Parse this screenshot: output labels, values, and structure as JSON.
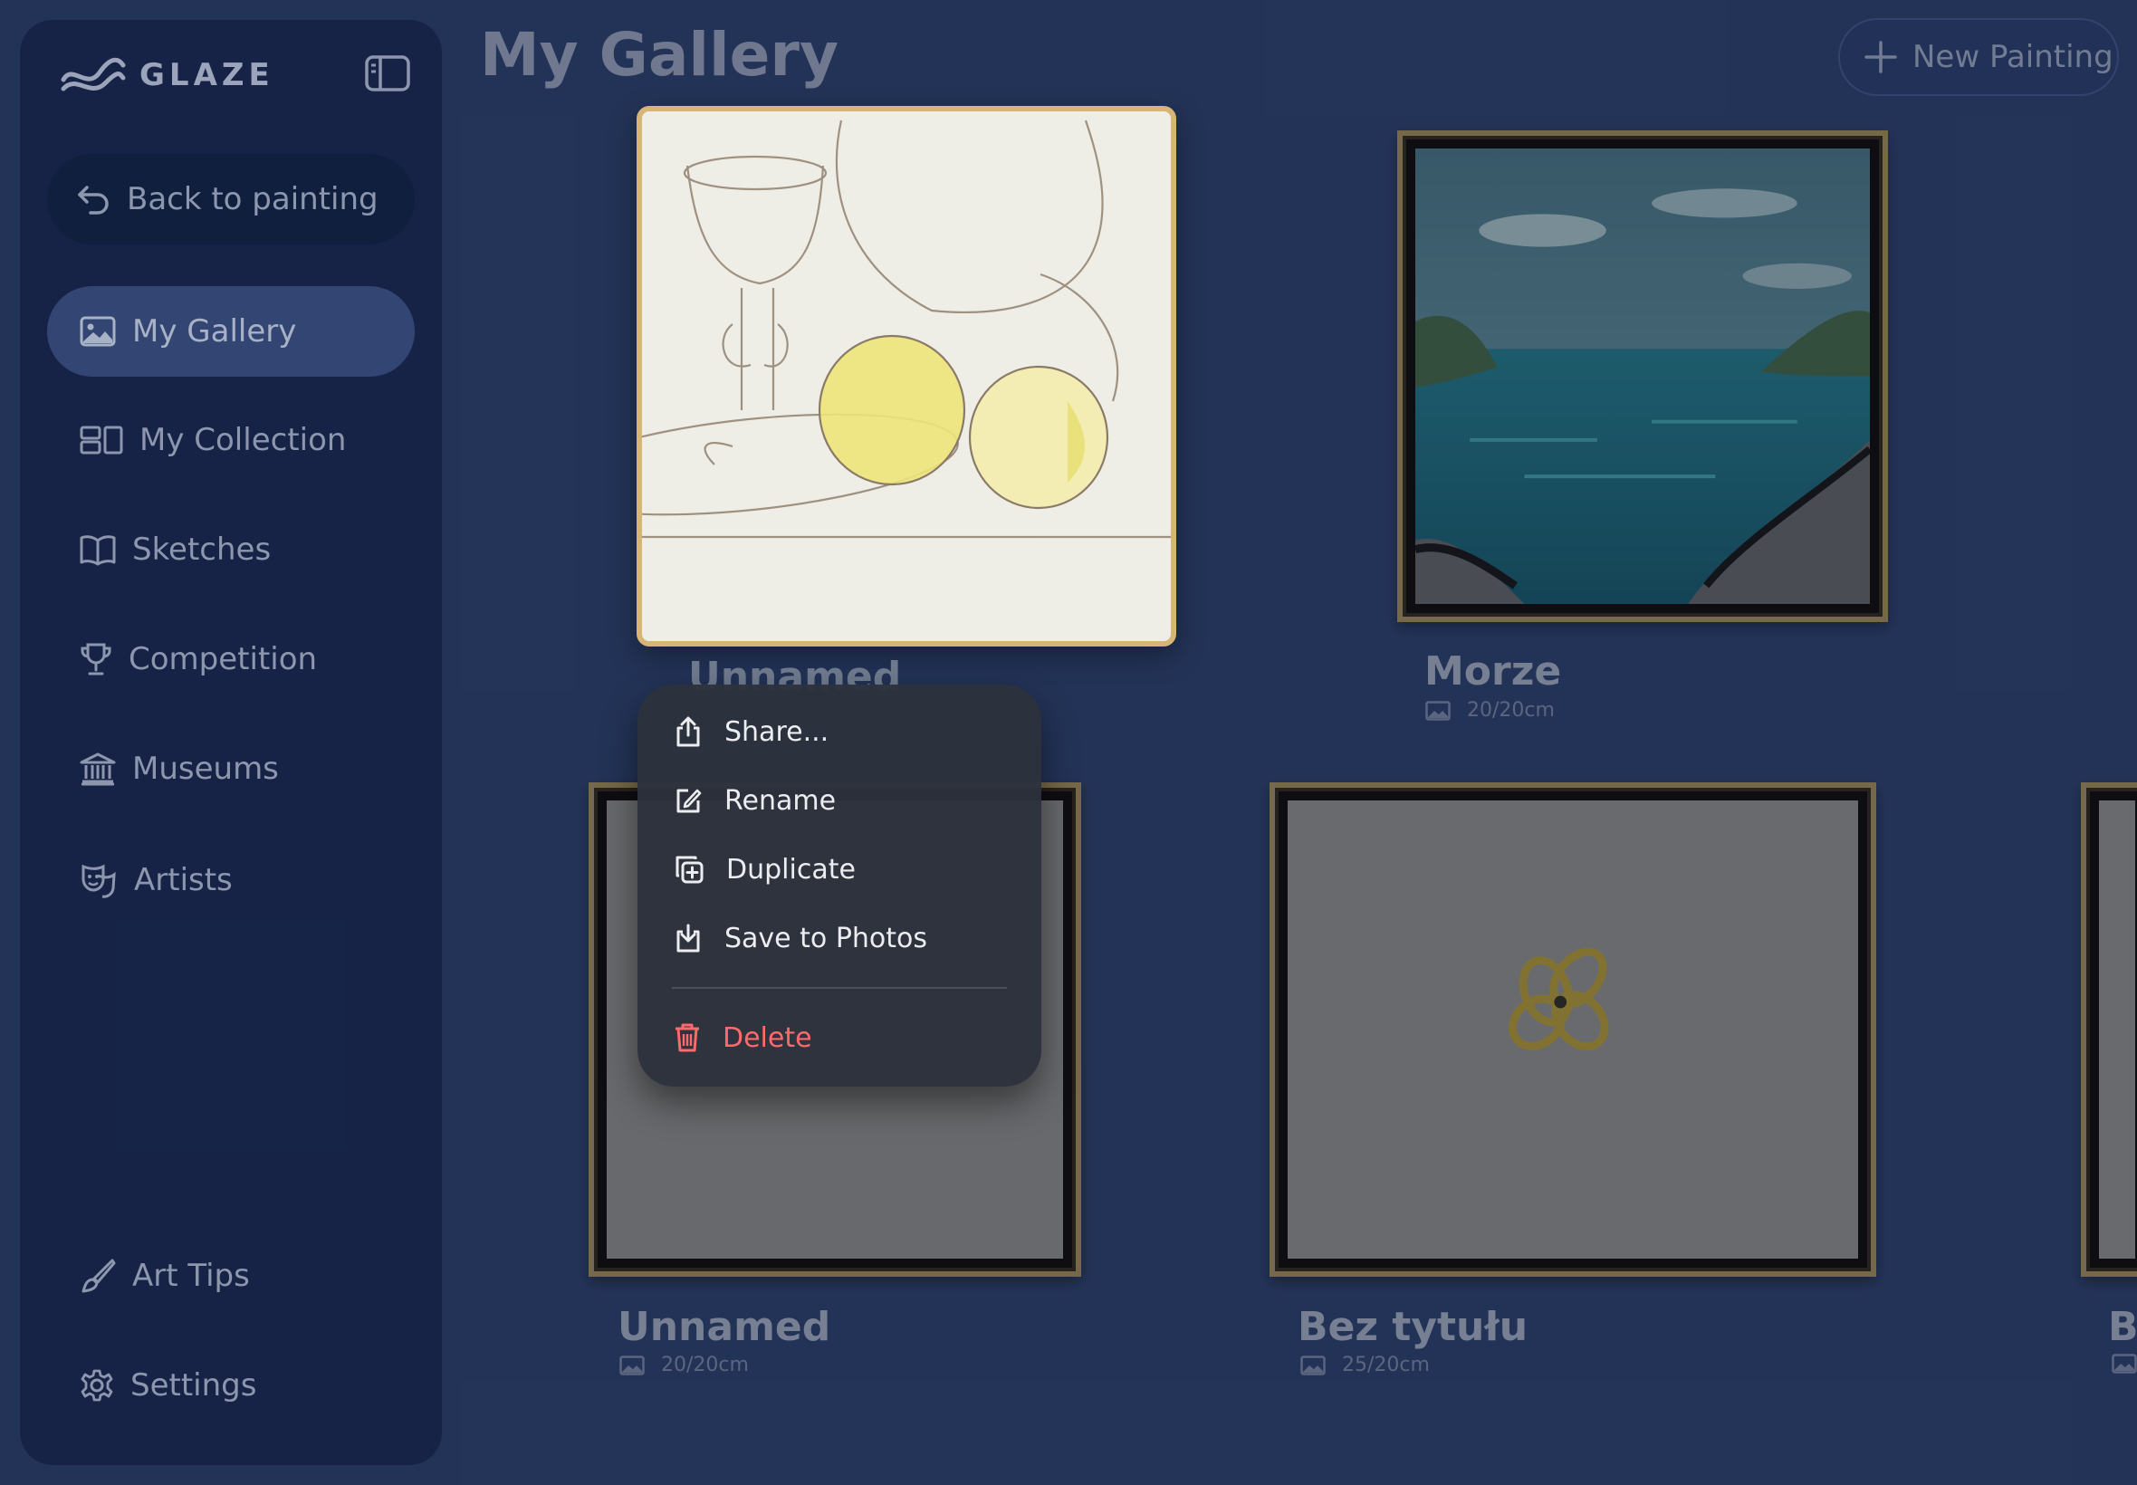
{
  "app": {
    "name": "GLAZE"
  },
  "sidebar": {
    "back_label": "Back to painting",
    "items": [
      {
        "label": "My Gallery",
        "icon": "image-icon",
        "active": true
      },
      {
        "label": "My Collection",
        "icon": "collection-icon"
      },
      {
        "label": "Sketches",
        "icon": "book-icon"
      },
      {
        "label": "Competition",
        "icon": "trophy-icon"
      },
      {
        "label": "Museums",
        "icon": "museum-icon"
      },
      {
        "label": "Artists",
        "icon": "theater-masks-icon"
      }
    ],
    "bottom_items": [
      {
        "label": "Art Tips",
        "icon": "brush-icon"
      },
      {
        "label": "Settings",
        "icon": "gear-icon"
      }
    ]
  },
  "header": {
    "title": "My Gallery",
    "new_button": "New Painting"
  },
  "gallery": {
    "paintings": [
      {
        "title": "Unnamed",
        "meta": ""
      },
      {
        "title": "Morze",
        "meta": "20/20cm"
      },
      {
        "title": "Unnamed",
        "meta": "20/20cm"
      },
      {
        "title": "Bez tytułu",
        "meta": "25/20cm"
      },
      {
        "title": "B",
        "meta": ""
      }
    ]
  },
  "context_menu": {
    "items": [
      {
        "label": "Share...",
        "icon": "share-icon"
      },
      {
        "label": "Rename",
        "icon": "rename-icon"
      },
      {
        "label": "Duplicate",
        "icon": "duplicate-icon"
      },
      {
        "label": "Save to Photos",
        "icon": "save-to-photos-icon"
      },
      {
        "label": "Delete",
        "icon": "trash-icon",
        "destructive": true
      }
    ]
  },
  "colors": {
    "background": "#27395f",
    "sidebar": "#16254a",
    "active_item": "#3a4f80",
    "delete": "#ff6a6a",
    "frame_gold": "#8c7a4e"
  }
}
